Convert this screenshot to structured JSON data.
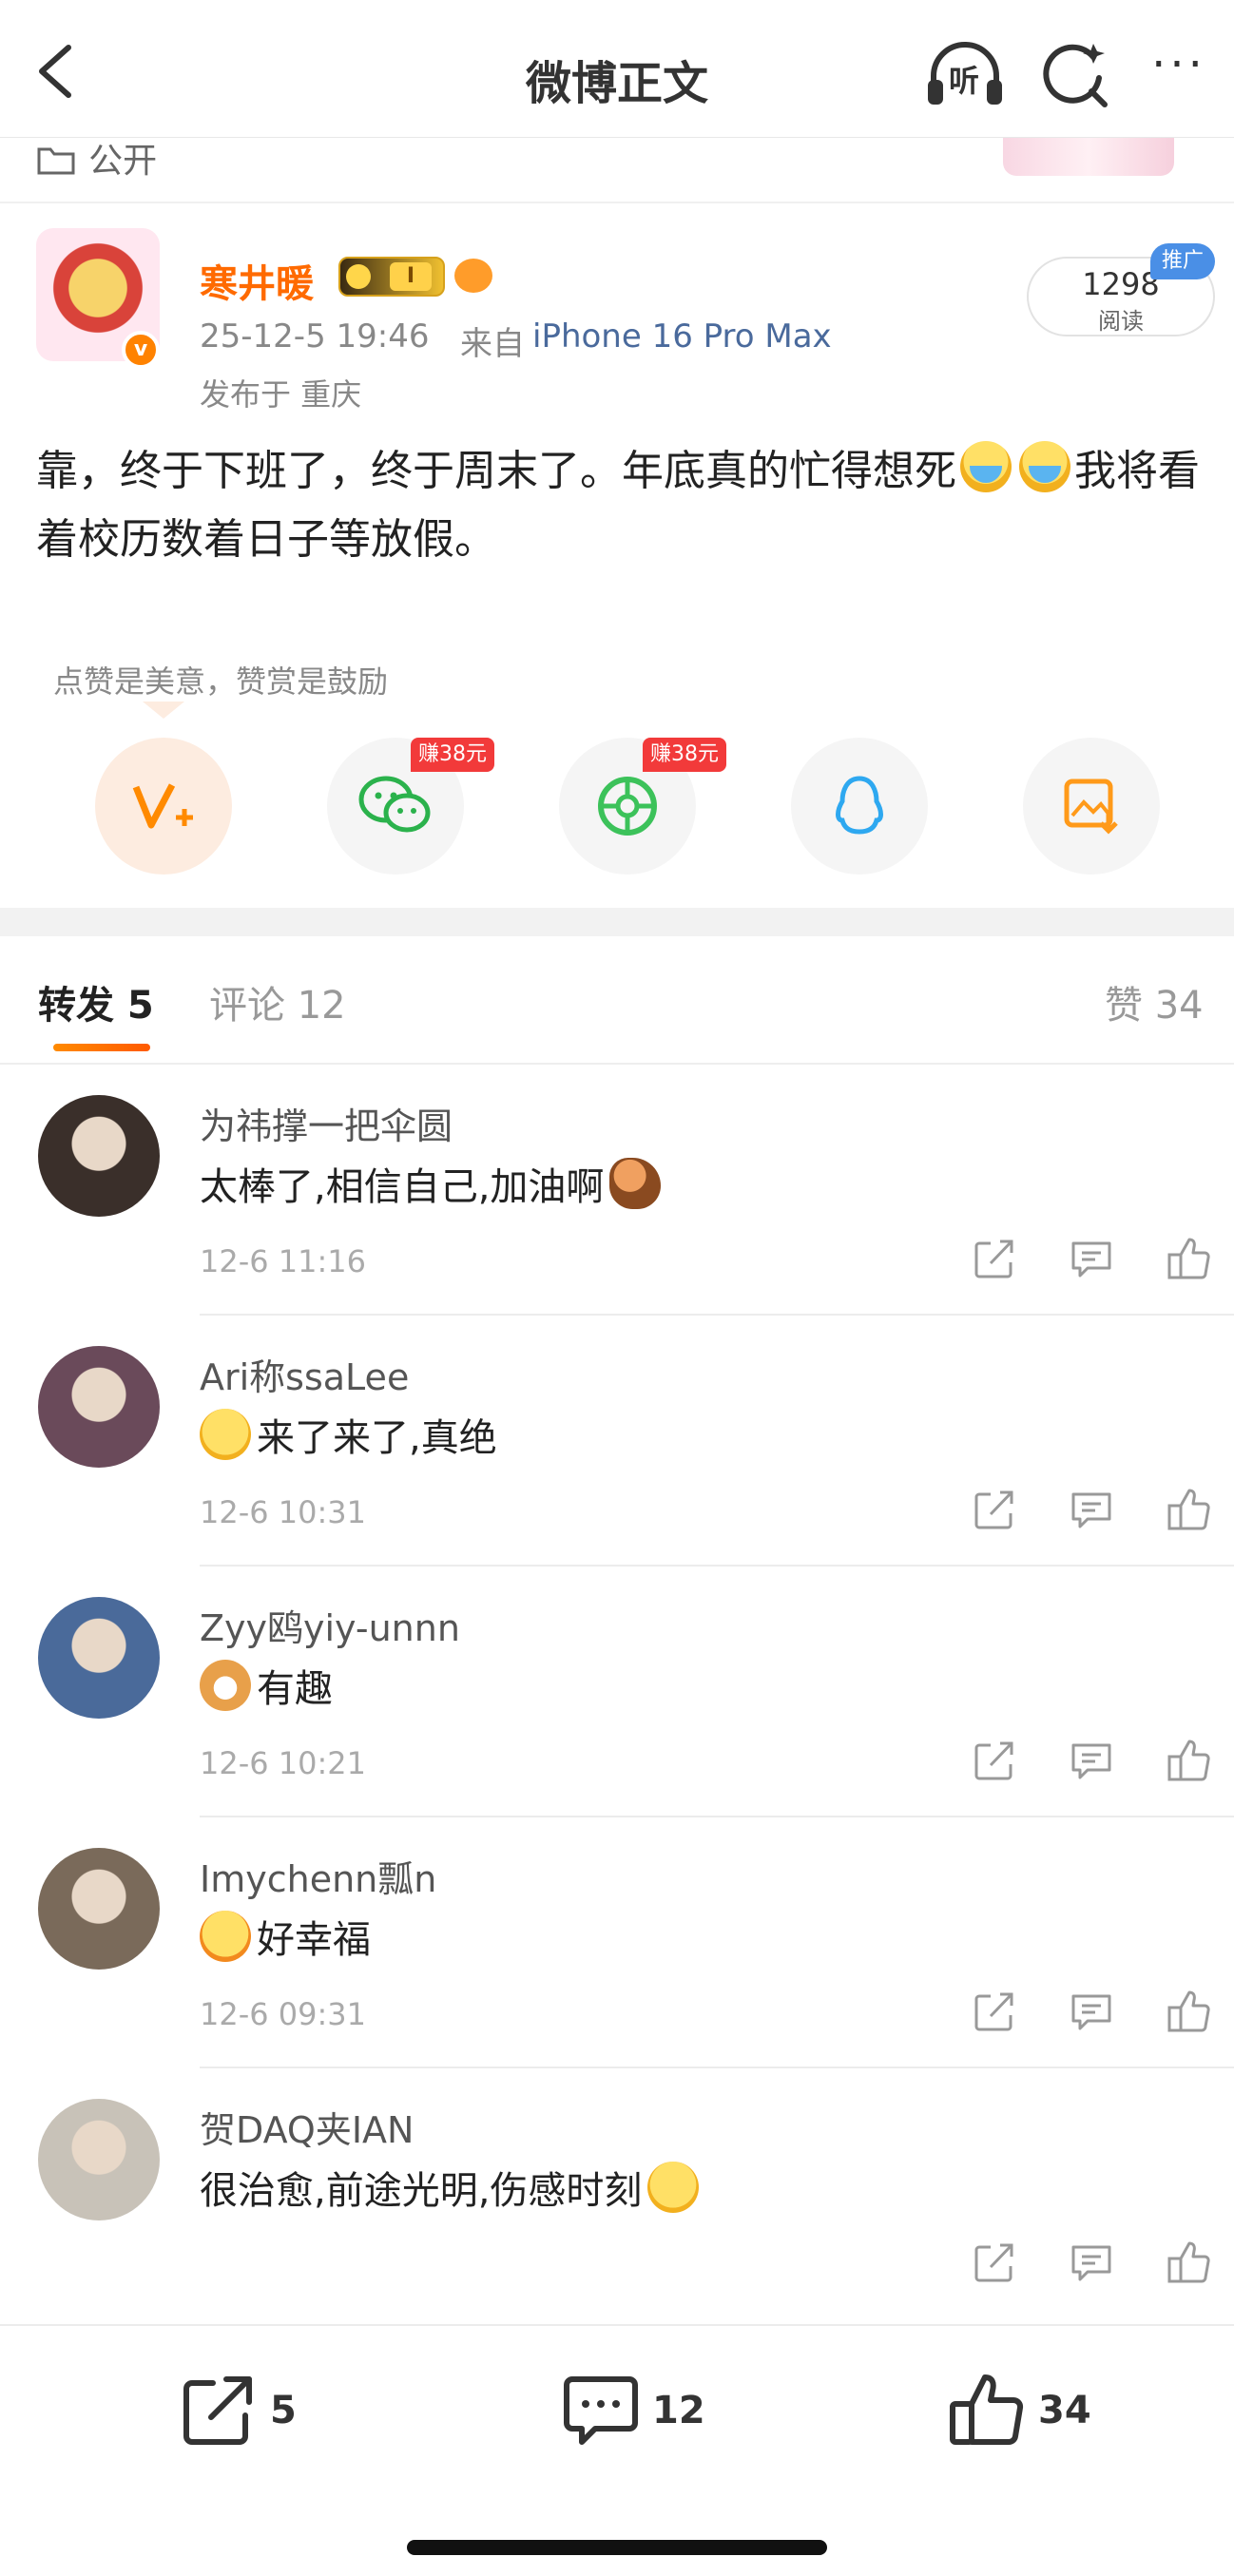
{
  "nav": {
    "title": "微博正文",
    "listen_label": "听",
    "more_label": "···"
  },
  "visibility": {
    "label": "公开"
  },
  "post": {
    "author": "寒井暖",
    "vip_level": "I",
    "time": "25-12-5 19:46",
    "source_prefix": "来自",
    "source": "iPhone 16 Pro Max",
    "location": "发布于 重庆",
    "read_count": "1298",
    "read_label": "阅读",
    "promo_label": "推广",
    "body_part1": "靠，终于下班了，终于周末了。年底真的忙得想死",
    "body_part2": "我将看着校历数着日子等放假。"
  },
  "tip": {
    "text": "点赞是美意，赞赏是鼓励",
    "earn_wechat": "赚38元",
    "earn_moments": "赚38元"
  },
  "tabs": {
    "repost": "转发 5",
    "comment": "评论 12",
    "like": "赞 34"
  },
  "comments": [
    {
      "name": "为祎撑一把伞圆",
      "text": "太棒了,相信自己,加油啊",
      "time": "12-6 11:16",
      "avatar_color": "#3a2f2a"
    },
    {
      "name": "Ari称ssaLee",
      "text": "来了来了,真绝",
      "time": "12-6 10:31",
      "avatar_color": "#6a4a5a"
    },
    {
      "name": "Zyy鸥yiy-unnn",
      "text": "有趣",
      "time": "12-6 10:21",
      "avatar_color": "#4a6a9a"
    },
    {
      "name": "Imychenn瓢n",
      "text": "好幸福",
      "time": "12-6 09:31",
      "avatar_color": "#7a6a5a"
    },
    {
      "name": "贺DAQ夹IAN",
      "text": "很治愈,前途光明,伤感时刻",
      "time": "",
      "avatar_color": "#c8c2b8"
    }
  ],
  "bottom": {
    "repost_count": "5",
    "comment_count": "12",
    "like_count": "34"
  },
  "colors": {
    "accent": "#ff8200",
    "author_name": "#ff6a00",
    "source_link": "#4a6a9c",
    "promo": "#4a8fe6"
  },
  "icons": [
    "back-icon",
    "headphones-icon",
    "refresh-icon",
    "more-icon",
    "folder-icon",
    "wechat-icon",
    "moments-icon",
    "qq-icon",
    "save-image-icon",
    "share-icon",
    "comment-icon",
    "like-icon"
  ]
}
